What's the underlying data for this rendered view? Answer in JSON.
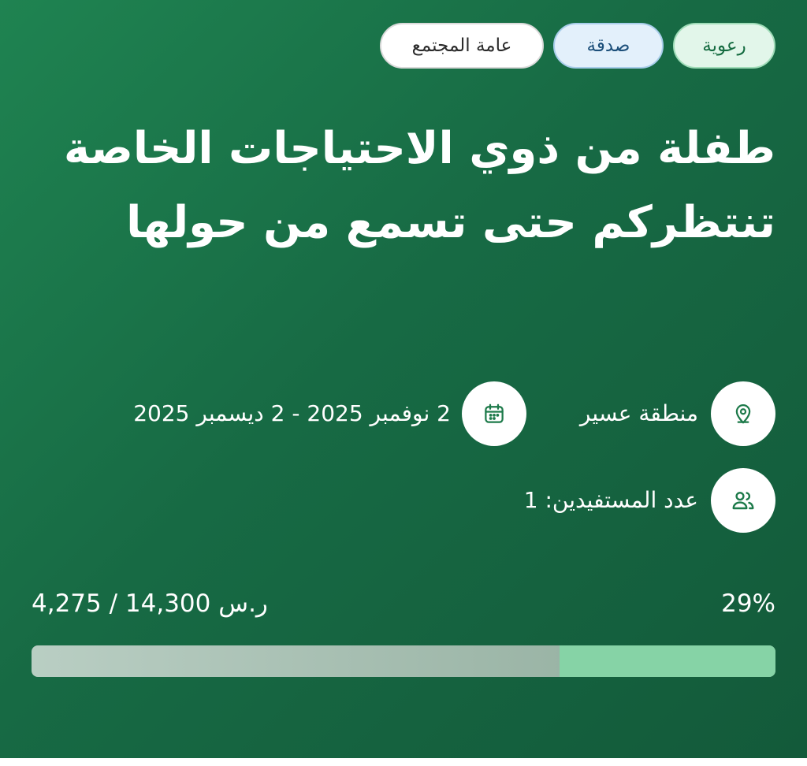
{
  "tags": {
    "category": "رعوية",
    "type": "صدقة",
    "audience": "عامة المجتمع"
  },
  "title": "طفلة من ذوي الاحتياجات الخاصة تنتظركم حتى تسمع من حولها",
  "info": {
    "location": "منطقة عسير",
    "location_icon": "location-pin-icon",
    "date_range": "2 نوفمبر 2025 - 2 ديسمبر 2025",
    "date_icon": "calendar-icon",
    "beneficiaries": "عدد المستفيدين: 1",
    "beneficiaries_icon": "users-icon"
  },
  "progress": {
    "percent_label": "29%",
    "fraction": 0.29,
    "amount_label": "4,275 / 14,300 ر.س"
  },
  "colors": {
    "card_bg": "#1a7248",
    "progress_fill": "#86d3a6",
    "icon_color": "#1d7a4a"
  }
}
